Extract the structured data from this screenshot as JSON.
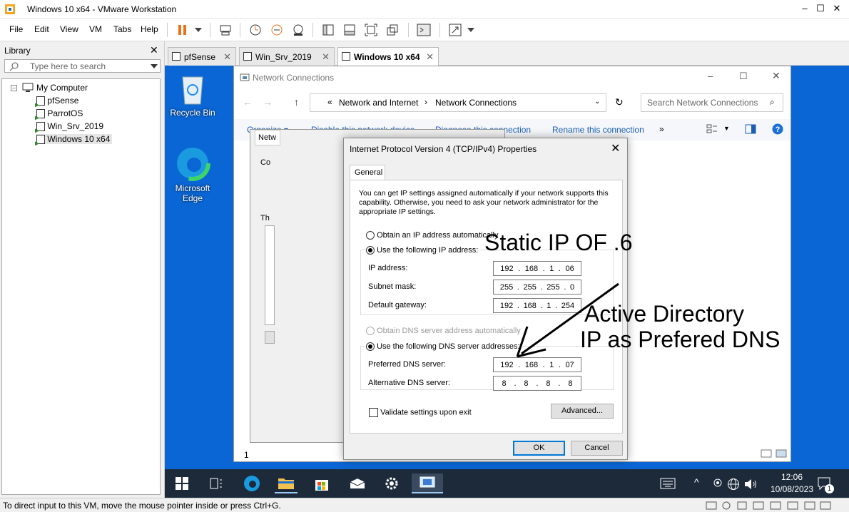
{
  "window": {
    "title": "Windows 10 x64 - VMware Workstation"
  },
  "menu": [
    "File",
    "Edit",
    "View",
    "VM",
    "Tabs",
    "Help"
  ],
  "library": {
    "header": "Library",
    "search_placeholder": "Type here to search",
    "root": "My Computer",
    "vms": [
      "pfSense",
      "ParrotOS",
      "Win_Srv_2019",
      "Windows 10 x64"
    ]
  },
  "tabs": [
    {
      "label": "pfSense",
      "active": false
    },
    {
      "label": "Win_Srv_2019",
      "active": false
    },
    {
      "label": "Windows 10 x64",
      "active": true
    }
  ],
  "desktop": {
    "icons": [
      "Recycle Bin",
      "Microsoft Edge"
    ]
  },
  "network_connections": {
    "title": "Network Connections",
    "breadcrumb": [
      "Network and Internet",
      "Network Connections"
    ],
    "search_placeholder": "Search Network Connections",
    "commands": [
      "Organize ▾",
      "Disable this network device",
      "Diagnose this connection",
      "Rename this connection",
      "»"
    ],
    "eth_tab": "Netw",
    "eth_fragments": [
      "Co",
      "Th",
      "1"
    ]
  },
  "ipv4_dialog": {
    "title": "Internet Protocol Version 4 (TCP/IPv4) Properties",
    "tab": "General",
    "description": "You can get IP settings assigned automatically if your network supports this capability. Otherwise, you need to ask your network administrator for the appropriate IP settings.",
    "auto_ip_label": "Obtain an IP address automatically",
    "manual_ip_label": "Use the following IP address:",
    "fields": [
      {
        "label": "IP address:",
        "value": [
          "192",
          "168",
          "1",
          "06"
        ]
      },
      {
        "label": "Subnet mask:",
        "value": [
          "255",
          "255",
          "255",
          "0"
        ]
      },
      {
        "label": "Default gateway:",
        "value": [
          "192",
          "168",
          "1",
          "254"
        ]
      }
    ],
    "auto_dns_label": "Obtain DNS server address automatically",
    "manual_dns_label": "Use the following DNS server addresses:",
    "dns_fields": [
      {
        "label": "Preferred DNS server:",
        "value": [
          "192",
          "168",
          "1",
          "07"
        ]
      },
      {
        "label": "Alternative DNS server:",
        "value": [
          "8",
          "8",
          "8",
          "8"
        ]
      }
    ],
    "validate_label": "Validate settings upon exit",
    "advanced_label": "Advanced...",
    "ok_label": "OK",
    "cancel_label": "Cancel"
  },
  "annotations": {
    "static": "Static IP OF .6",
    "ad_line1": "Active Directory",
    "ad_line2": "IP as Prefered DNS"
  },
  "taskbar": {
    "time": "12:06",
    "date": "10/08/2023",
    "notification_count": "1"
  },
  "status_bar": "To direct input to this VM, move the mouse pointer inside or press Ctrl+G."
}
